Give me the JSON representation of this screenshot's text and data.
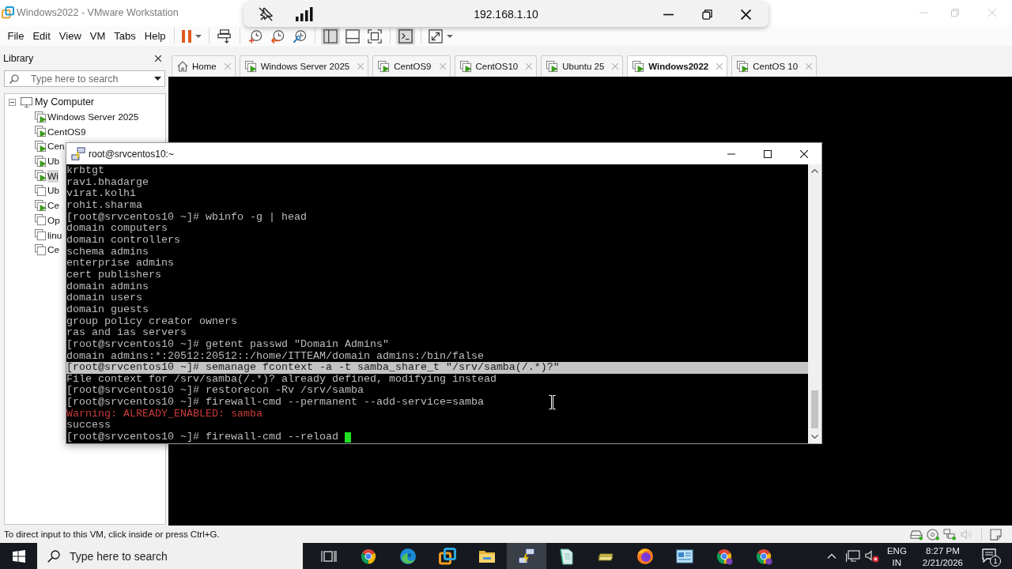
{
  "window": {
    "title": "Windows2022 - VMware Workstation"
  },
  "remote_bar": {
    "address": "192.168.1.10"
  },
  "menu": [
    "File",
    "Edit",
    "View",
    "VM",
    "Tabs",
    "Help"
  ],
  "toolbar": [
    [
      {
        "kind": "pause",
        "pressed": false
      }
    ],
    [
      {
        "kind": "send_keys",
        "pressed": false
      }
    ],
    [
      {
        "kind": "snapshot",
        "pressed": false
      },
      {
        "kind": "revert",
        "pressed": false
      },
      {
        "kind": "snapshot_manager",
        "pressed": false
      }
    ],
    [
      {
        "kind": "library",
        "pressed": true
      },
      {
        "kind": "thumbnails",
        "pressed": false
      },
      {
        "kind": "full_screen",
        "pressed": false
      }
    ],
    [
      {
        "kind": "console",
        "pressed": true
      }
    ],
    [
      {
        "kind": "stretch",
        "pressed": false
      }
    ]
  ],
  "library": {
    "title": "Library",
    "search": {
      "placeholder": "Type here to search"
    },
    "tree": [
      {
        "label": "My Computer",
        "expanded": true,
        "children": [
          {
            "label": "Windows Server 2025",
            "running": true,
            "selected": false
          },
          {
            "label": "CentOS9",
            "running": true,
            "selected": false
          },
          {
            "label": "Cen",
            "running": true,
            "selected": false
          },
          {
            "label": "Ub",
            "running": true,
            "selected": false
          },
          {
            "label": "Wi",
            "running": true,
            "selected": true
          },
          {
            "label": "Ub",
            "running": false,
            "selected": false
          },
          {
            "label": "Ce",
            "running": true,
            "selected": false
          },
          {
            "label": "Op",
            "running": false,
            "selected": false
          },
          {
            "label": "linu",
            "running": false,
            "selected": false
          },
          {
            "label": "Ce",
            "running": false,
            "selected": false
          }
        ]
      }
    ]
  },
  "tabs": [
    {
      "label": "Home",
      "kind": "home",
      "selected": false
    },
    {
      "label": "Windows Server 2025",
      "kind": "vm",
      "selected": false
    },
    {
      "label": "CentOS9",
      "kind": "vm",
      "selected": false
    },
    {
      "label": "CentOS10",
      "kind": "vm",
      "selected": false
    },
    {
      "label": "Ubuntu 25",
      "kind": "vm",
      "selected": false
    },
    {
      "label": "Windows2022",
      "kind": "vm",
      "selected": true
    },
    {
      "label": "CentOS 10",
      "kind": "vm",
      "selected": false
    }
  ],
  "terminal_window": {
    "title": "root@srvcentos10:~",
    "cursor": true,
    "lines": [
      {
        "text": "krbtgt",
        "kind": "text",
        "selected": false
      },
      {
        "text": "ravi.bhadarge",
        "kind": "text",
        "selected": false
      },
      {
        "text": "virat.kolhi",
        "kind": "text",
        "selected": false
      },
      {
        "text": "rohit.sharma",
        "kind": "text",
        "selected": false
      },
      {
        "text": "[root@srvcentos10 ~]# wbinfo -g | head",
        "kind": "text",
        "selected": false
      },
      {
        "text": "domain computers",
        "kind": "text",
        "selected": false
      },
      {
        "text": "domain controllers",
        "kind": "text",
        "selected": false
      },
      {
        "text": "schema admins",
        "kind": "text",
        "selected": false
      },
      {
        "text": "enterprise admins",
        "kind": "text",
        "selected": false
      },
      {
        "text": "cert publishers",
        "kind": "text",
        "selected": false
      },
      {
        "text": "domain admins",
        "kind": "text",
        "selected": false
      },
      {
        "text": "domain users",
        "kind": "text",
        "selected": false
      },
      {
        "text": "domain guests",
        "kind": "text",
        "selected": false
      },
      {
        "text": "group policy creator owners",
        "kind": "text",
        "selected": false
      },
      {
        "text": "ras and ias servers",
        "kind": "text",
        "selected": false
      },
      {
        "text": "[root@srvcentos10 ~]# getent passwd \"Domain Admins\"",
        "kind": "text",
        "selected": false
      },
      {
        "text": "domain admins:*:20512:20512::/home/ITTEAM/domain admins:/bin/false",
        "kind": "text",
        "selected": false
      },
      {
        "text": "[root@srvcentos10 ~]# semanage fcontext -a -t samba_share_t \"/srv/samba(/.*)?\"",
        "kind": "text",
        "selected": true
      },
      {
        "text": "File context for /srv/samba(/.*)? already defined, modifying instead",
        "kind": "text",
        "selected": false
      },
      {
        "text": "[root@srvcentos10 ~]# restorecon -Rv /srv/samba",
        "kind": "text",
        "selected": false
      },
      {
        "text": "[root@srvcentos10 ~]# firewall-cmd --permanent --add-service=samba",
        "kind": "text",
        "selected": false
      },
      {
        "text": "Warning: ALREADY_ENABLED: samba",
        "kind": "warning",
        "selected": false
      },
      {
        "text": "success",
        "kind": "text",
        "selected": false
      },
      {
        "text": "[root@srvcentos10 ~]# firewall-cmd --reload",
        "kind": "text",
        "selected": false
      }
    ]
  },
  "status_bar": {
    "message": "To direct input to this VM, click inside or press Ctrl+G.",
    "devices": [
      {
        "kind": "hard_disk",
        "connected": true
      },
      {
        "kind": "cd",
        "connected": true
      },
      {
        "kind": "network",
        "connected": true
      },
      {
        "kind": "sound",
        "connected": false
      }
    ]
  },
  "taskbar": {
    "search": {
      "placeholder": "Type here to search"
    },
    "apps": [
      {
        "kind": "task_view",
        "active": false
      },
      {
        "kind": "chrome",
        "active": false
      },
      {
        "kind": "edge",
        "active": false
      },
      {
        "kind": "vmware",
        "active": false
      },
      {
        "kind": "explorer",
        "active": false
      },
      {
        "kind": "putty",
        "active": true
      },
      {
        "kind": "notepad",
        "active": false
      },
      {
        "kind": "cash",
        "active": false
      },
      {
        "kind": "firefox",
        "active": false
      },
      {
        "kind": "remote",
        "active": false
      },
      {
        "kind": "chrome_profile",
        "active": false
      },
      {
        "kind": "chrome_profile",
        "active": false
      }
    ],
    "tray": {
      "language": "ENG",
      "region": "IN",
      "time": "8:27 PM",
      "date": "2/21/2026",
      "notification_count": "1"
    }
  }
}
